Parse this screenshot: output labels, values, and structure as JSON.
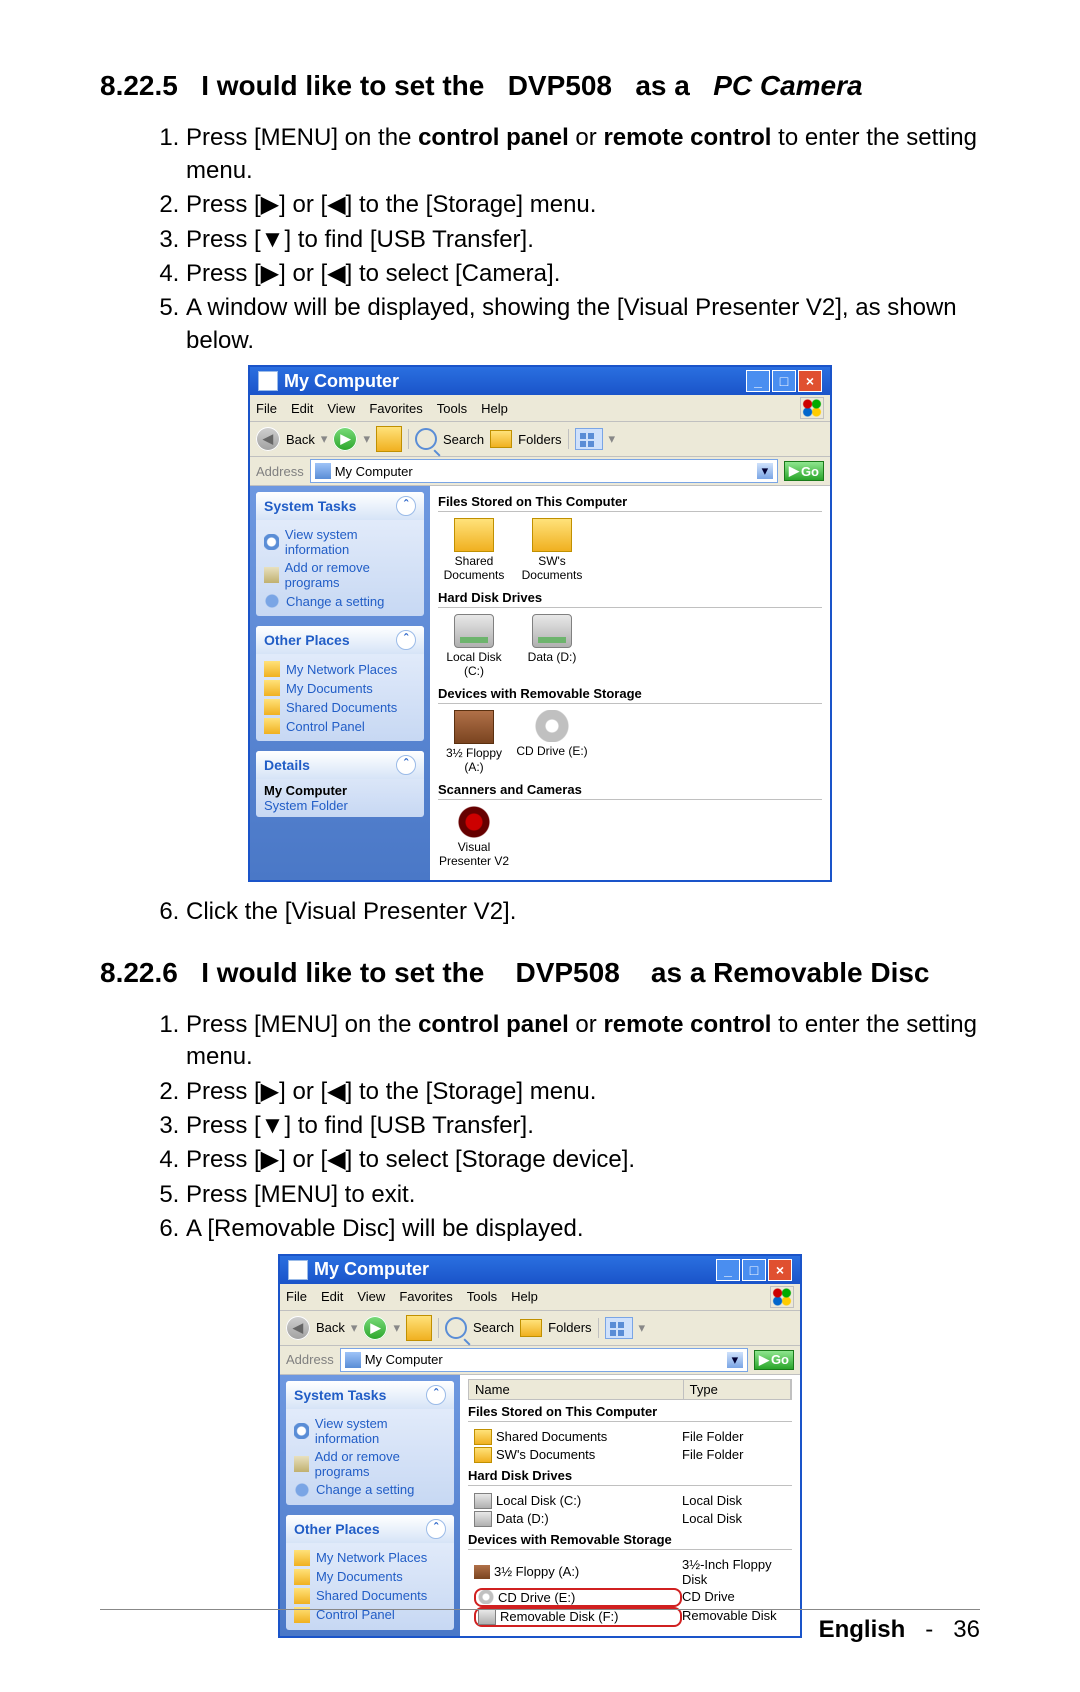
{
  "section5": {
    "number": "8.22.5",
    "title_pre": "I would like to set the",
    "model": "DVP508",
    "title_post_as_a": "as a",
    "title_italic": "PC Camera",
    "steps": [
      "Press [MENU] on the <b>control panel</b> or <b>remote control</b> to enter the setting menu.",
      "Press [▶] or [◀] to the [Storage] menu.",
      "Press [▼] to find [USB Transfer].",
      "Press [▶] or [◀] to select [Camera].",
      "A window will be displayed, showing the [Visual Presenter V2], as shown below."
    ],
    "step6": "Click the [Visual Presenter V2]."
  },
  "section6": {
    "number": "8.22.6",
    "title_pre": "I would like to set the",
    "model": "DVP508",
    "title_post": "as a Removable Disc",
    "steps": [
      "Press [MENU] on the <b>control panel</b> or <b>remote control</b> to enter the setting menu.",
      "Press [▶] or [◀] to the [Storage] menu.",
      "Press [▼] to find [USB Transfer].",
      "Press [▶] or [◀] to select [Storage device].",
      "Press [MENU] to exit.",
      "A [Removable Disc] will be displayed."
    ]
  },
  "xp": {
    "title": "My Computer",
    "menu": [
      "File",
      "Edit",
      "View",
      "Favorites",
      "Tools",
      "Help"
    ],
    "toolbar": {
      "back": "Back",
      "search": "Search",
      "folders": "Folders"
    },
    "addr_label": "Address",
    "addr_value": "My Computer",
    "go": "Go",
    "side": {
      "tasks_hdr": "System Tasks",
      "tasks": [
        "View system information",
        "Add or remove programs",
        "Change a setting"
      ],
      "other_hdr": "Other Places",
      "other": [
        "My Network Places",
        "My Documents",
        "Shared Documents",
        "Control Panel"
      ],
      "details_hdr": "Details",
      "details_title": "My Computer",
      "details_sub": "System Folder"
    },
    "groups": {
      "files_hdr": "Files Stored on This Computer",
      "files": [
        "Shared Documents",
        "SW's Documents"
      ],
      "drives_hdr": "Hard Disk Drives",
      "drives": [
        "Local Disk (C:)",
        "Data (D:)"
      ],
      "remov_hdr": "Devices with Removable Storage",
      "remov": [
        "3½ Floppy (A:)",
        "CD Drive (E:)"
      ],
      "scan_hdr": "Scanners and Cameras",
      "scan": [
        "Visual Presenter V2"
      ]
    }
  },
  "xp2": {
    "list_hdr": {
      "name": "Name",
      "type": "Type"
    },
    "files": [
      {
        "name": "Shared Documents",
        "type": "File Folder"
      },
      {
        "name": "SW's Documents",
        "type": "File Folder"
      }
    ],
    "drives": [
      {
        "name": "Local Disk (C:)",
        "type": "Local Disk"
      },
      {
        "name": "Data (D:)",
        "type": "Local Disk"
      }
    ],
    "remov": [
      {
        "name": "3½ Floppy (A:)",
        "type": "3½-Inch Floppy Disk"
      },
      {
        "name": "CD Drive (E:)",
        "type": "CD Drive",
        "hl": true
      },
      {
        "name": "Removable Disk (F:)",
        "type": "Removable Disk",
        "hl": true
      }
    ]
  },
  "footer": {
    "lang": "English",
    "sep": "-",
    "page": "36"
  }
}
